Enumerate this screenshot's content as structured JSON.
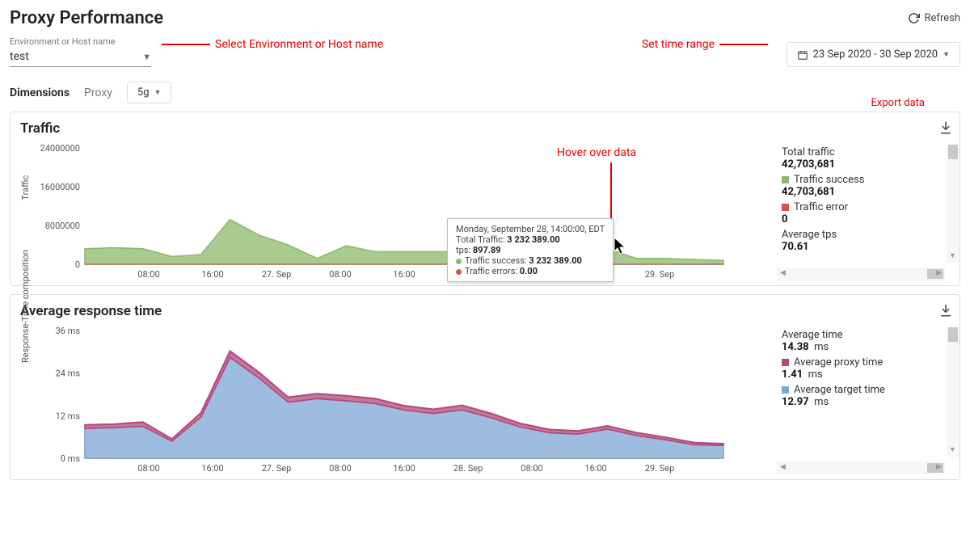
{
  "header": {
    "title": "Proxy Performance",
    "refresh_label": "Refresh"
  },
  "topbar": {
    "env_label": "Environment or Host name",
    "env_value": "test",
    "date_range": "23 Sep 2020 - 30 Sep 2020"
  },
  "annotations": {
    "select_env": "Select Environment or Host name",
    "set_time_range": "Set time range",
    "export_data": "Export data",
    "hover_over_data": "Hover over data"
  },
  "dimensions": {
    "label": "Dimensions",
    "proxy_label": "Proxy",
    "proxy_value": "5g"
  },
  "traffic": {
    "title": "Traffic",
    "ylabel": "Traffic",
    "legend": {
      "total_traffic_label": "Total traffic",
      "total_traffic_value": "42,703,681",
      "traffic_success_label": "Traffic success",
      "traffic_success_value": "42,703,681",
      "traffic_error_label": "Traffic error",
      "traffic_error_value": "0",
      "average_tps_label": "Average tps",
      "average_tps_value": "70.61"
    },
    "tooltip": {
      "timestamp": "Monday, September 28, 14:00:00, EDT",
      "total_traffic_label": "Total Traffic:",
      "total_traffic_value": "3 232 389.00",
      "tps_label": "tps:",
      "tps_value": "897.89",
      "success_label": "Traffic success:",
      "success_value": "3 232 389.00",
      "errors_label": "Traffic errors:",
      "errors_value": "0.00"
    }
  },
  "response_time": {
    "title": "Average response time",
    "ylabel": "Response-Time composition",
    "legend": {
      "avg_time_label": "Average time",
      "avg_time_value": "14.38",
      "avg_time_unit": "ms",
      "proxy_time_label": "Average proxy time",
      "proxy_time_value": "1.41",
      "proxy_time_unit": "ms",
      "target_time_label": "Average target time",
      "target_time_value": "12.97",
      "target_time_unit": "ms"
    }
  },
  "colors": {
    "traffic_success": "#8cba6a",
    "traffic_error": "#d95050",
    "proxy_time": "#b3487a",
    "target_time": "#7ea6d4"
  },
  "chart_data": [
    {
      "type": "area",
      "title": "Traffic",
      "ylabel": "Traffic",
      "ylim": [
        0,
        24000000
      ],
      "y_ticks": [
        0,
        8000000,
        16000000,
        24000000
      ],
      "x_ticks": [
        "08:00",
        "16:00",
        "27. Sep",
        "08:00",
        "16:00",
        "28. Sep",
        "08:00",
        "16:00",
        "29. Sep"
      ],
      "series": [
        {
          "name": "Traffic success",
          "color": "#8cba6a",
          "values": [
            3200000,
            3400000,
            3200000,
            1600000,
            2000000,
            9200000,
            6000000,
            4000000,
            1200000,
            3800000,
            2600000,
            2600000,
            2600000,
            2600000,
            3232389,
            2600000,
            200000,
            400000,
            3200000,
            1200000,
            1200000,
            1000000,
            800000
          ]
        },
        {
          "name": "Traffic errors",
          "color": "#d95050",
          "values": [
            0,
            0,
            0,
            0,
            0,
            0,
            0,
            0,
            0,
            0,
            0,
            0,
            0,
            0,
            0,
            0,
            0,
            0,
            0,
            0,
            0,
            0,
            0
          ]
        }
      ]
    },
    {
      "type": "area",
      "title": "Average response time",
      "ylabel": "Response-Time composition",
      "ylim": [
        0,
        36
      ],
      "y_unit": "ms",
      "y_ticks": [
        0,
        12,
        24,
        36
      ],
      "x_ticks": [
        "08:00",
        "16:00",
        "27. Sep",
        "08:00",
        "16:00",
        "28. Sep",
        "08:00",
        "16:00",
        "29. Sep"
      ],
      "series": [
        {
          "name": "Average target time",
          "color": "#7ea6d4",
          "values": [
            8.4,
            8.6,
            9.0,
            4.8,
            11.6,
            28.4,
            22.6,
            15.8,
            16.8,
            16.2,
            15.4,
            13.6,
            12.6,
            13.6,
            11.4,
            8.8,
            7.2,
            6.8,
            8.2,
            6.4,
            5.2,
            3.8,
            3.6
          ]
        },
        {
          "name": "Average proxy time",
          "color": "#b3487a",
          "values": [
            1.0,
            1.0,
            1.2,
            0.6,
            1.2,
            1.8,
            1.6,
            1.4,
            1.4,
            1.4,
            1.4,
            1.2,
            1.2,
            1.3,
            1.2,
            1.0,
            0.9,
            0.9,
            0.9,
            0.8,
            0.7,
            0.6,
            0.5
          ]
        }
      ]
    }
  ]
}
